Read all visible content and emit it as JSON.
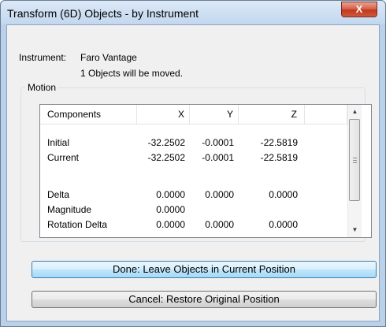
{
  "window": {
    "title": "Transform (6D) Objects - by Instrument",
    "close_label": "X"
  },
  "info": {
    "instrument_label": "Instrument:",
    "instrument_value": "Faro Vantage",
    "objects_message": "1 Objects will be moved."
  },
  "motion": {
    "group_label": "Motion",
    "columns": [
      "Components",
      "X",
      "Y",
      "Z"
    ],
    "rows": [
      {
        "name": "Initial",
        "x": "-32.2502",
        "y": "-0.0001",
        "z": "-22.5819"
      },
      {
        "name": "Current",
        "x": "-32.2502",
        "y": "-0.0001",
        "z": "-22.5819"
      },
      {
        "name": "",
        "x": "",
        "y": "",
        "z": ""
      },
      {
        "name": "Delta",
        "x": "0.0000",
        "y": "0.0000",
        "z": "0.0000"
      },
      {
        "name": "Magnitude",
        "x": "0.0000",
        "y": "",
        "z": ""
      },
      {
        "name": "Rotation Delta",
        "x": "0.0000",
        "y": "0.0000",
        "z": "0.0000"
      }
    ]
  },
  "buttons": {
    "done_label": "Done: Leave Objects in Current Position",
    "cancel_label": "Cancel: Restore Original Position"
  },
  "icons": {
    "scroll_up": "triangle-up",
    "scroll_down": "triangle-down",
    "scroll_grip": "three-line-grip"
  }
}
